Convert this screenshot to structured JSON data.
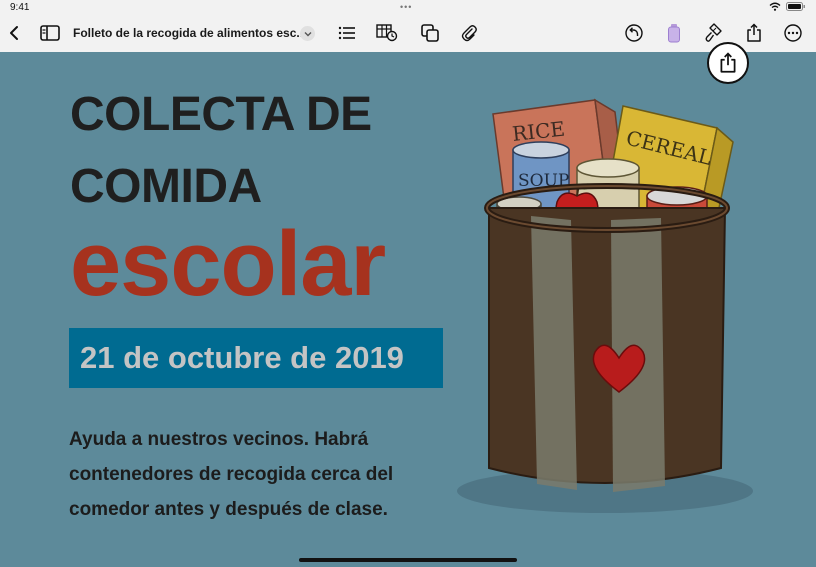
{
  "status_bar": {
    "time": "9:41",
    "more": "•••"
  },
  "toolbar": {
    "document_title": "Folleto de la recogida de alimentos esc...",
    "icons": [
      "back-chevron-icon",
      "sidebar-icon",
      "title-chevron-icon",
      "list-icon",
      "table-chart-icon",
      "shapes-icon",
      "attachment-icon",
      "undo-icon",
      "fill-icon",
      "brush-icon",
      "share-icon",
      "more-icon"
    ]
  },
  "document": {
    "heading_line1": "COLECTA DE",
    "heading_line2": "COMIDA",
    "heading_big": "escolar",
    "date": "21 de octubre de 2019",
    "body_line1": "Ayuda a nuestros vecinos. Habrá",
    "body_line2": "contenedores de recogida cerca del",
    "body_line3": "comedor antes y después de clase.",
    "illustration_labels": {
      "rice": "RICE",
      "cereal": "CEREAL",
      "soup": "SOUP"
    }
  },
  "colors": {
    "canvas": "#5d8a9a",
    "heading": "#1f1f1f",
    "accent_red": "#a6321e",
    "date_band": "#006b91",
    "toolbar_bg": "#f2f2f2",
    "heart": "#b81c1c"
  }
}
